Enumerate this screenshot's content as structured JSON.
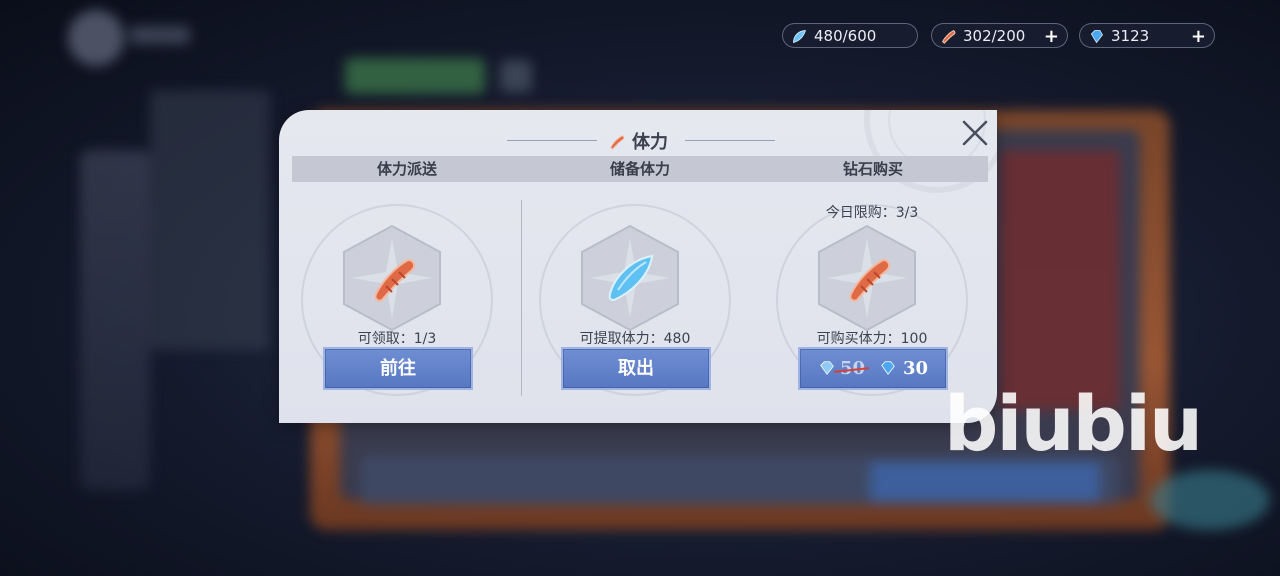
{
  "resources": [
    {
      "icon": "stamina-crystal-icon",
      "value": "480/600",
      "has_plus": false
    },
    {
      "icon": "sausage-stamina-icon",
      "value": "302/200",
      "has_plus": true
    },
    {
      "icon": "diamond-icon",
      "value": "3123",
      "has_plus": true
    }
  ],
  "dialog": {
    "title": "体力",
    "title_icon": "sausage-stamina-icon",
    "columns": [
      {
        "header": "体力派送",
        "top_note": "",
        "item_icon": "sausage-stamina-icon",
        "note": "可领取：1/3",
        "button": "前往"
      },
      {
        "header": "储备体力",
        "top_note": "",
        "item_icon": "stamina-crystal-icon",
        "note": "可提取体力：480",
        "button": "取出"
      },
      {
        "header": "钻石购买",
        "top_note": "今日限购：3/3",
        "item_icon": "sausage-stamina-icon",
        "note": "可购买体力：100",
        "button_price_old": "50",
        "button_price_new": "30"
      }
    ]
  },
  "watermark": "biubiu",
  "colors": {
    "accent_button": "#5f7fc8",
    "dialog_bg": "#e4e6ee",
    "header_bg": "#c5c8d3",
    "strike": "#d2433a"
  }
}
